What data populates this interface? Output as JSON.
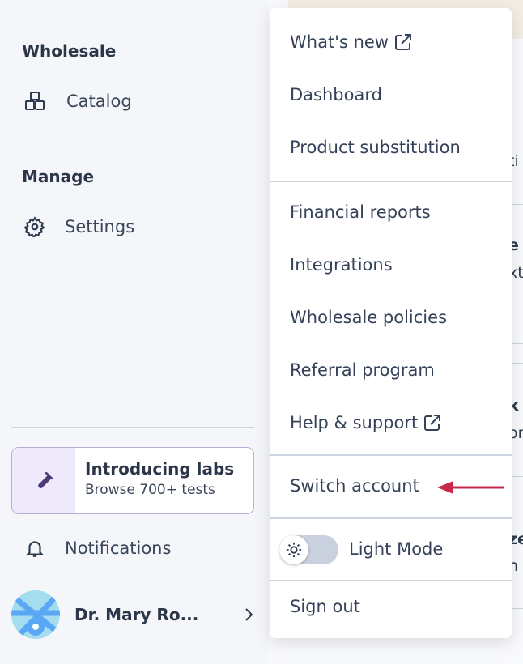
{
  "sidebar": {
    "sections": [
      {
        "title": "Wholesale",
        "items": [
          {
            "label": "Catalog",
            "icon": "catalog-boxes-icon"
          }
        ]
      },
      {
        "title": "Manage",
        "items": [
          {
            "label": "Settings",
            "icon": "gear-icon"
          }
        ]
      }
    ],
    "promo": {
      "title": "Introducing labs",
      "subtitle": "Browse 700+ tests",
      "icon": "test-tube-icon"
    },
    "notifications": {
      "label": "Notifications",
      "icon": "bell-icon"
    },
    "user": {
      "name": "Dr. Mary Ro...",
      "icon": "chevron-right-icon"
    }
  },
  "background_fragments": [
    "ti",
    "e",
    "xt",
    "k",
    "or",
    "ze",
    "n"
  ],
  "menu": {
    "items": [
      {
        "label": "What's new",
        "icon": "external-link-icon"
      },
      {
        "label": "Dashboard"
      },
      {
        "label": "Product substitution"
      },
      {
        "label": "Financial reports"
      },
      {
        "label": "Integrations"
      },
      {
        "label": "Wholesale policies"
      },
      {
        "label": "Referral program"
      },
      {
        "label": "Help & support",
        "icon": "external-link-icon"
      },
      {
        "label": "Switch account"
      }
    ],
    "theme_toggle": {
      "label": "Light Mode",
      "icon": "sun-icon",
      "on": false
    },
    "sign_out": "Sign out"
  },
  "annotation": {
    "type": "arrow",
    "color": "#c8294a"
  }
}
